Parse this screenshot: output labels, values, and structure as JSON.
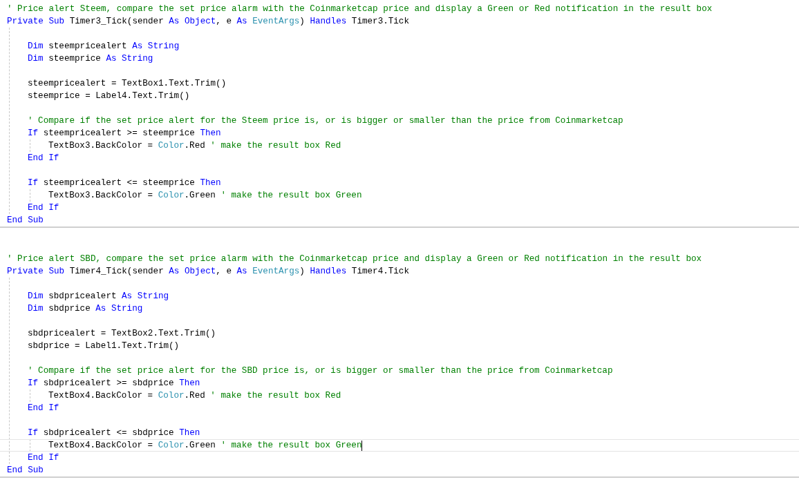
{
  "editor": {
    "lines": [
      {
        "kind": "code",
        "current": false,
        "tokens": [
          {
            "kind": "comment",
            "text": "' Price alert Steem, compare the set price alarm with the Coinmarketcap price and display a Green or Red notification in the result box"
          }
        ]
      },
      {
        "kind": "code",
        "current": false,
        "tokens": [
          {
            "kind": "keyword",
            "text": "Private Sub"
          },
          {
            "kind": "plain",
            "text": " Timer3_Tick(sender "
          },
          {
            "kind": "keyword",
            "text": "As Object"
          },
          {
            "kind": "plain",
            "text": ", e "
          },
          {
            "kind": "keyword",
            "text": "As"
          },
          {
            "kind": "type",
            "text": " EventArgs"
          },
          {
            "kind": "plain",
            "text": ") "
          },
          {
            "kind": "keyword",
            "text": "Handles"
          },
          {
            "kind": "plain",
            "text": " Timer3.Tick"
          }
        ],
        "children": [
          {
            "kind": "blank"
          },
          {
            "kind": "code",
            "current": false,
            "tokens": [
              {
                "kind": "keyword",
                "text": "Dim"
              },
              {
                "kind": "plain",
                "text": " steempricealert "
              },
              {
                "kind": "keyword",
                "text": "As String"
              }
            ]
          },
          {
            "kind": "code",
            "current": false,
            "tokens": [
              {
                "kind": "keyword",
                "text": "Dim"
              },
              {
                "kind": "plain",
                "text": " steemprice "
              },
              {
                "kind": "keyword",
                "text": "As String"
              }
            ]
          },
          {
            "kind": "blank"
          },
          {
            "kind": "code",
            "current": false,
            "tokens": [
              {
                "kind": "plain",
                "text": "steempricealert = TextBox1.Text.Trim()"
              }
            ]
          },
          {
            "kind": "code",
            "current": false,
            "tokens": [
              {
                "kind": "plain",
                "text": "steemprice = Label4.Text.Trim()"
              }
            ]
          },
          {
            "kind": "blank"
          },
          {
            "kind": "code",
            "current": false,
            "tokens": [
              {
                "kind": "comment",
                "text": "' Compare if the set price alert for the Steem price is, or is bigger or smaller than the price from Coinmarketcap"
              }
            ]
          },
          {
            "kind": "code",
            "current": false,
            "tokens": [
              {
                "kind": "keyword",
                "text": "If"
              },
              {
                "kind": "plain",
                "text": " steempricealert >= steemprice "
              },
              {
                "kind": "keyword",
                "text": "Then"
              }
            ],
            "children": [
              {
                "kind": "code",
                "current": false,
                "tokens": [
                  {
                    "kind": "plain",
                    "text": "TextBox3.BackColor = "
                  },
                  {
                    "kind": "type",
                    "text": "Color"
                  },
                  {
                    "kind": "plain",
                    "text": ".Red "
                  },
                  {
                    "kind": "comment",
                    "text": "' make the result box Red"
                  }
                ]
              }
            ]
          },
          {
            "kind": "code",
            "current": false,
            "tokens": [
              {
                "kind": "keyword",
                "text": "End If"
              }
            ]
          },
          {
            "kind": "blank"
          },
          {
            "kind": "code",
            "current": false,
            "tokens": [
              {
                "kind": "keyword",
                "text": "If"
              },
              {
                "kind": "plain",
                "text": " steempricealert <= steemprice "
              },
              {
                "kind": "keyword",
                "text": "Then"
              }
            ],
            "children": [
              {
                "kind": "code",
                "current": false,
                "tokens": [
                  {
                    "kind": "plain",
                    "text": "TextBox3.BackColor = "
                  },
                  {
                    "kind": "type",
                    "text": "Color"
                  },
                  {
                    "kind": "plain",
                    "text": ".Green "
                  },
                  {
                    "kind": "comment",
                    "text": "' make the result box Green"
                  }
                ]
              }
            ]
          },
          {
            "kind": "code",
            "current": false,
            "tokens": [
              {
                "kind": "keyword",
                "text": "End If"
              }
            ]
          }
        ]
      },
      {
        "kind": "code",
        "current": false,
        "tokens": [
          {
            "kind": "keyword",
            "text": "End Sub"
          }
        ]
      },
      {
        "kind": "separator"
      },
      {
        "kind": "blank"
      },
      {
        "kind": "blank"
      },
      {
        "kind": "code",
        "current": false,
        "tokens": [
          {
            "kind": "comment",
            "text": "' Price alert SBD, compare the set price alarm with the Coinmarketcap price and display a Green or Red notification in the result box"
          }
        ]
      },
      {
        "kind": "code",
        "current": false,
        "tokens": [
          {
            "kind": "keyword",
            "text": "Private Sub"
          },
          {
            "kind": "plain",
            "text": " Timer4_Tick(sender "
          },
          {
            "kind": "keyword",
            "text": "As Object"
          },
          {
            "kind": "plain",
            "text": ", e "
          },
          {
            "kind": "keyword",
            "text": "As"
          },
          {
            "kind": "type",
            "text": " EventArgs"
          },
          {
            "kind": "plain",
            "text": ") "
          },
          {
            "kind": "keyword",
            "text": "Handles"
          },
          {
            "kind": "plain",
            "text": " Timer4.Tick"
          }
        ],
        "children": [
          {
            "kind": "blank"
          },
          {
            "kind": "code",
            "current": false,
            "tokens": [
              {
                "kind": "keyword",
                "text": "Dim"
              },
              {
                "kind": "plain",
                "text": " sbdpricealert "
              },
              {
                "kind": "keyword",
                "text": "As String"
              }
            ]
          },
          {
            "kind": "code",
            "current": false,
            "tokens": [
              {
                "kind": "keyword",
                "text": "Dim"
              },
              {
                "kind": "plain",
                "text": " sbdprice "
              },
              {
                "kind": "keyword",
                "text": "As String"
              }
            ]
          },
          {
            "kind": "blank"
          },
          {
            "kind": "code",
            "current": false,
            "tokens": [
              {
                "kind": "plain",
                "text": "sbdpricealert = TextBox2.Text.Trim()"
              }
            ]
          },
          {
            "kind": "code",
            "current": false,
            "tokens": [
              {
                "kind": "plain",
                "text": "sbdprice = Label1.Text.Trim()"
              }
            ]
          },
          {
            "kind": "blank"
          },
          {
            "kind": "code",
            "current": false,
            "tokens": [
              {
                "kind": "comment",
                "text": "' Compare if the set price alert for the SBD price is, or is bigger or smaller than the price from Coinmarketcap"
              }
            ]
          },
          {
            "kind": "code",
            "current": false,
            "tokens": [
              {
                "kind": "keyword",
                "text": "If"
              },
              {
                "kind": "plain",
                "text": " sbdpricealert >= sbdprice "
              },
              {
                "kind": "keyword",
                "text": "Then"
              }
            ],
            "children": [
              {
                "kind": "code",
                "current": false,
                "tokens": [
                  {
                    "kind": "plain",
                    "text": "TextBox4.BackColor = "
                  },
                  {
                    "kind": "type",
                    "text": "Color"
                  },
                  {
                    "kind": "plain",
                    "text": ".Red "
                  },
                  {
                    "kind": "comment",
                    "text": "' make the result box Red"
                  }
                ]
              }
            ]
          },
          {
            "kind": "code",
            "current": false,
            "tokens": [
              {
                "kind": "keyword",
                "text": "End If"
              }
            ]
          },
          {
            "kind": "blank"
          },
          {
            "kind": "code",
            "current": false,
            "tokens": [
              {
                "kind": "keyword",
                "text": "If"
              },
              {
                "kind": "plain",
                "text": " sbdpricealert <= sbdprice "
              },
              {
                "kind": "keyword",
                "text": "Then"
              }
            ],
            "children": [
              {
                "kind": "code",
                "current": true,
                "tokens": [
                  {
                    "kind": "plain",
                    "text": "TextBox4.BackColor = "
                  },
                  {
                    "kind": "type",
                    "text": "Color"
                  },
                  {
                    "kind": "plain",
                    "text": ".Green "
                  },
                  {
                    "kind": "comment",
                    "text": "' make the result box Green"
                  }
                ]
              }
            ]
          },
          {
            "kind": "code",
            "current": false,
            "tokens": [
              {
                "kind": "keyword",
                "text": "End If"
              }
            ]
          }
        ]
      },
      {
        "kind": "code",
        "current": false,
        "tokens": [
          {
            "kind": "keyword",
            "text": "End Sub"
          }
        ]
      },
      {
        "kind": "separator"
      }
    ]
  }
}
